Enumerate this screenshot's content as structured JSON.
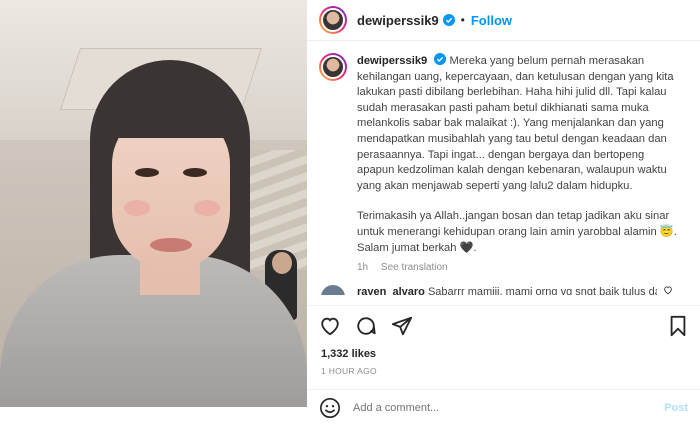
{
  "header": {
    "username": "dewiperssik9",
    "separator": "•",
    "follow_label": "Follow"
  },
  "caption": {
    "username": "dewiperssik9",
    "paragraph1": "Mereka yang belum pernah merasakan kehilangan uang, kepercayaan, dan ketulusan dengan yang kita lakukan pasti dibilang berlebihan. Haha hihi julid dll. Tapi kalau sudah merasakan pasti paham betul dikhianati sama muka melankolis sabar bak malaikat :). Yang menjalankan dan yang mendapatkan musibahlah yang tau betul dengan keadaan dan perasaannya. Tapi ingat... dengan bergaya dan bertopeng apapun kedzoliman kalah dengan kebenaran, walaupun waktu yang akan menjawab seperti yang lalu2 dalam hidupku.",
    "paragraph2": "Terimakasih ya Allah..jangan bosan dan tetap jadikan aku sinar untuk menerangi kehidupan orang lain amin yarobbal alamin 😇. Salam jumat berkah 🖤.",
    "time": "1h",
    "see_translation": "See translation"
  },
  "comment": {
    "username": "rayen_alvaro",
    "text": "Sabarrr mamiii, mami orng yg sngt baik tulus dan"
  },
  "actions": {
    "likes": "1,332 likes",
    "time_ago": "1 HOUR AGO"
  },
  "add_comment": {
    "placeholder": "Add a comment...",
    "post_label": "Post"
  },
  "colors": {
    "accent": "#0095f6",
    "post_disabled": "#b2dffc",
    "muted": "#8e8e8e",
    "verified": "#0095f6"
  }
}
